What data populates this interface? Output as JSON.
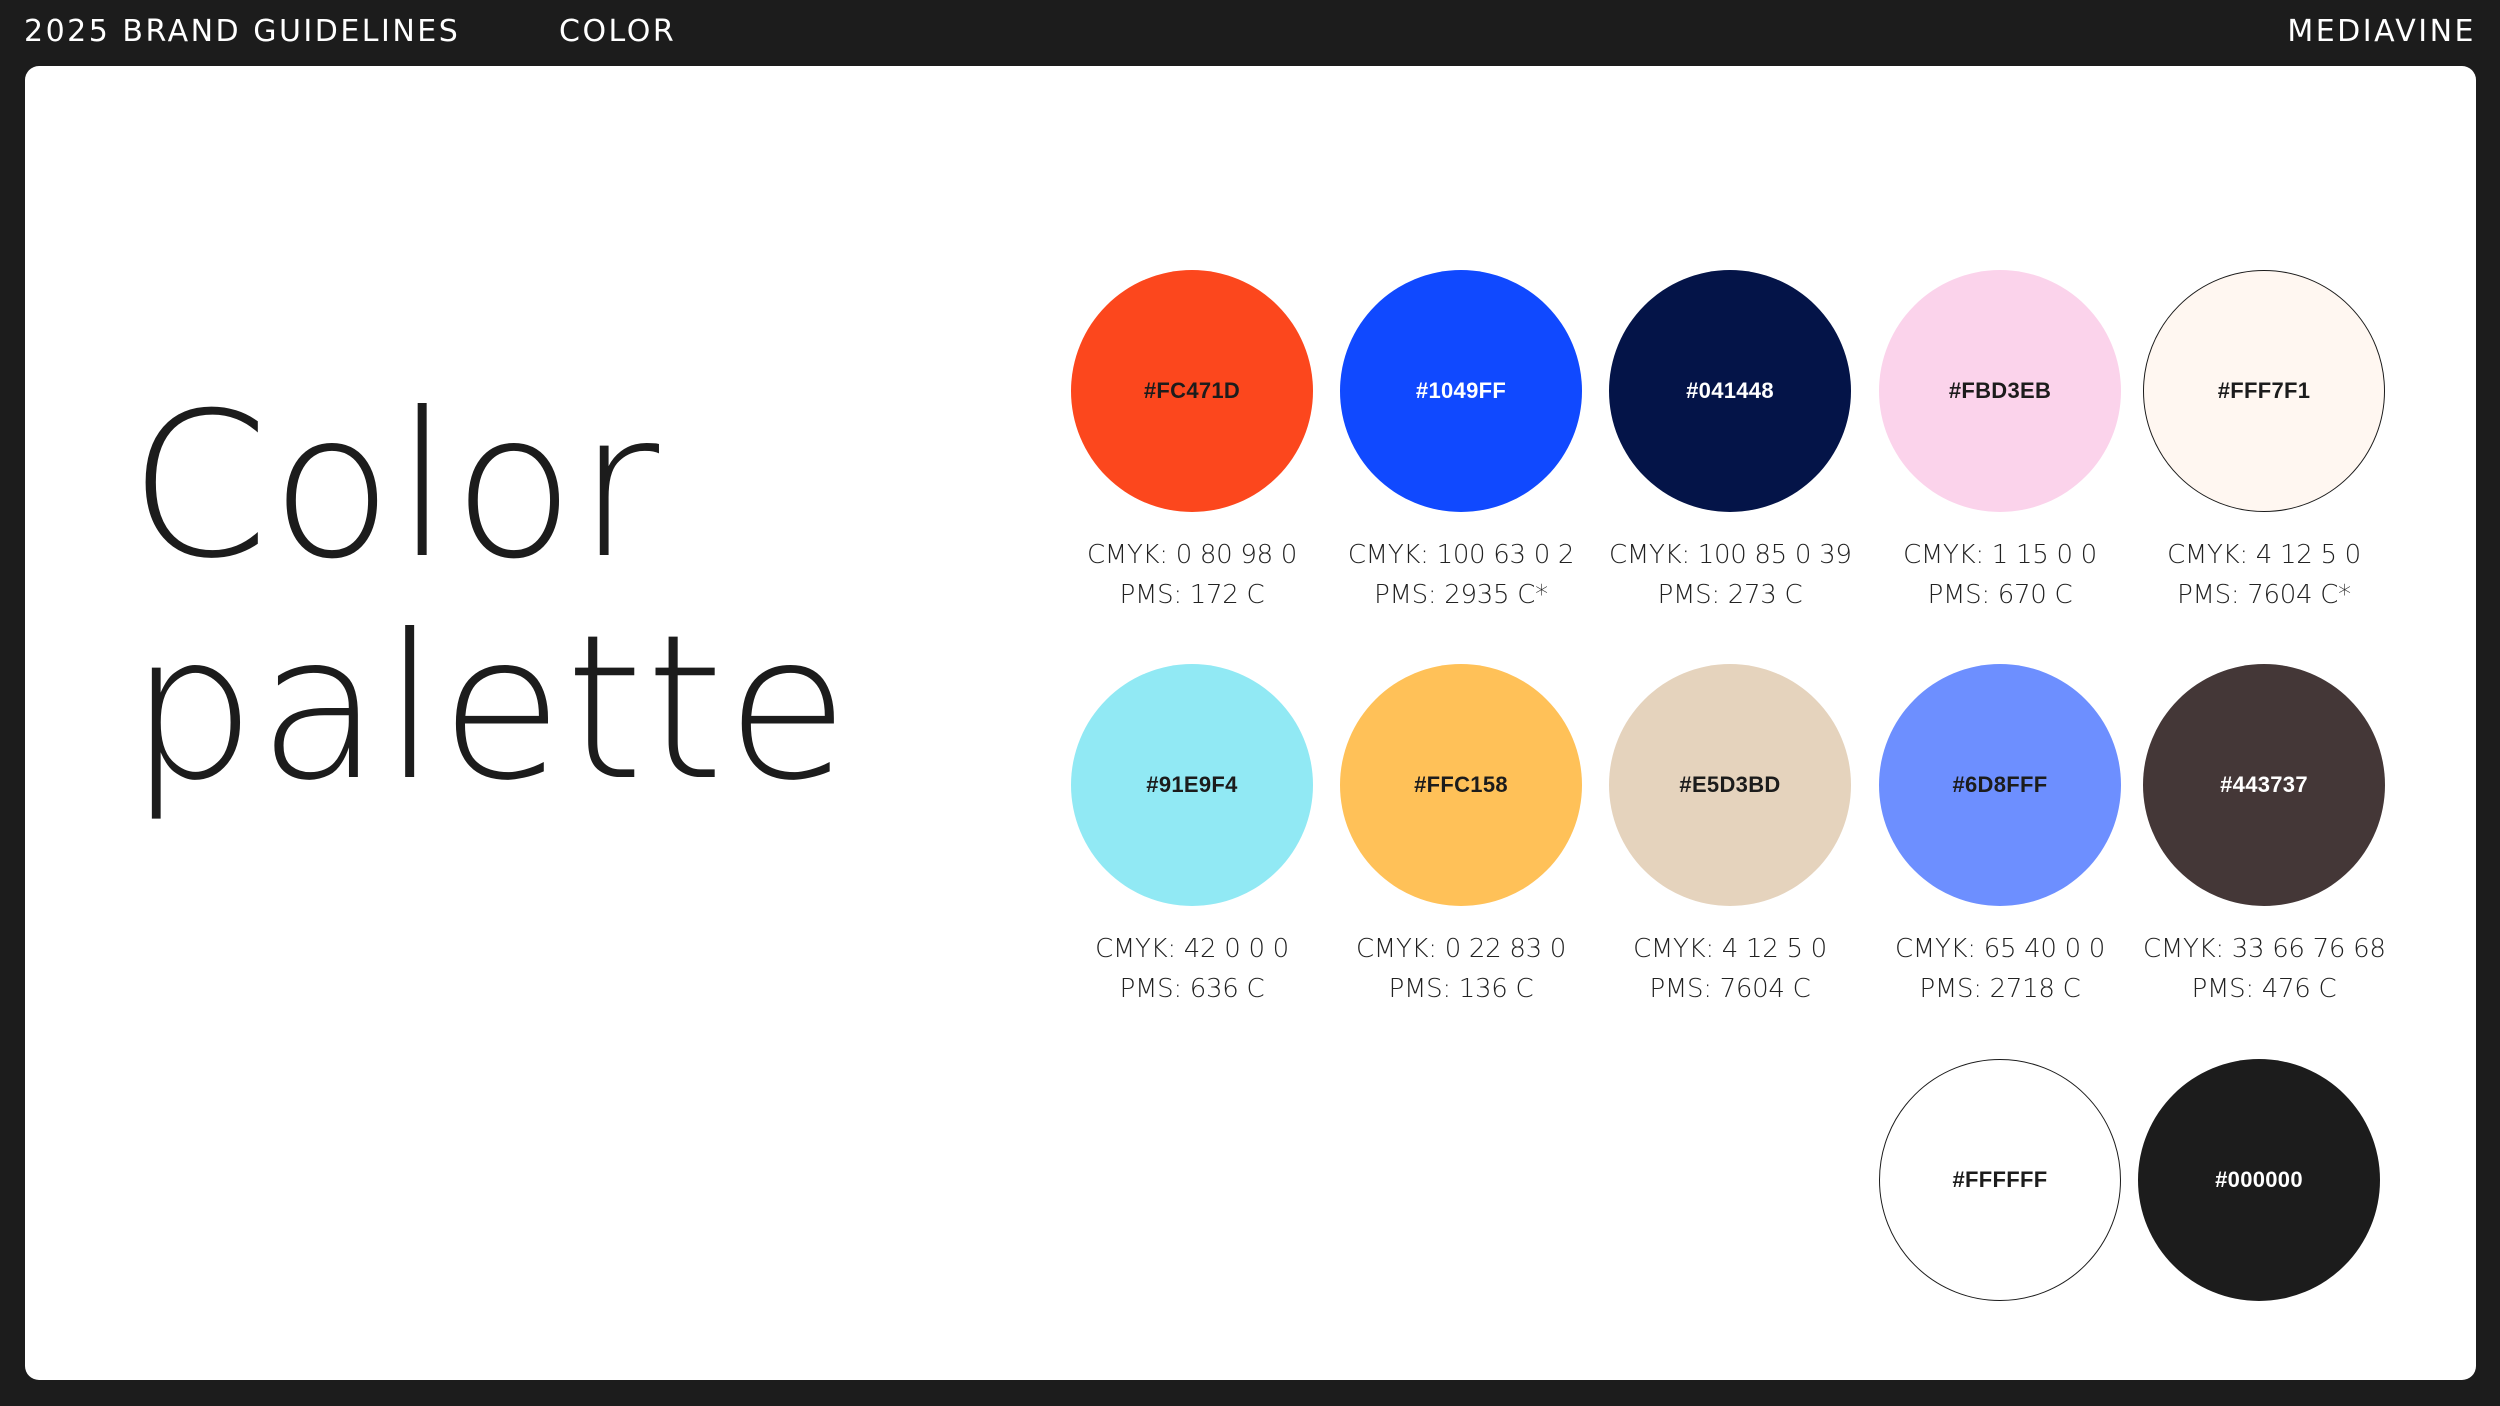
{
  "header": {
    "left": "2025 BRAND GUIDELINES",
    "center": "COLOR",
    "right": "MEDIAVINE"
  },
  "title": {
    "line1": "Color",
    "line2": "palette"
  },
  "swatches": [
    {
      "hex": "#FC471D",
      "fill": "#FC471D",
      "text_color": "#1c1c1c",
      "cmyk": "CMYK: 0 80 98 0",
      "pms": "PMS: 172 C"
    },
    {
      "hex": "#1049FF",
      "fill": "#1049FF",
      "text_color": "#ffffff",
      "cmyk": "CMYK: 100 63 0 2",
      "pms": "PMS: 2935 C*"
    },
    {
      "hex": "#041448",
      "fill": "#041448",
      "text_color": "#ffffff",
      "cmyk": "CMYK: 100 85 0 39",
      "pms": "PMS: 273 C"
    },
    {
      "hex": "#FBD3EB",
      "fill": "#FBD3EB",
      "text_color": "#1c1c1c",
      "cmyk": "CMYK: 1 15 0 0",
      "pms": "PMS: 670 C"
    },
    {
      "hex": "#FFF7F1",
      "fill": "#FFF7F1",
      "text_color": "#1c1c1c",
      "outlined": true,
      "cmyk": "CMYK: 4 12 5 0",
      "pms": "PMS: 7604 C*"
    },
    {
      "hex": "#91E9F4",
      "fill": "#91E9F4",
      "text_color": "#1c1c1c",
      "cmyk": "CMYK: 42 0 0 0",
      "pms": "PMS: 636 C"
    },
    {
      "hex": "#FFC158",
      "fill": "#FFC158",
      "text_color": "#1c1c1c",
      "cmyk": "CMYK: 0 22 83 0",
      "pms": "PMS: 136 C"
    },
    {
      "hex": "#E5D3BD",
      "fill": "#E5D3BD",
      "text_color": "#1c1c1c",
      "cmyk": "CMYK: 4 12 5 0",
      "pms": "PMS: 7604 C"
    },
    {
      "hex": "#6D8FFF",
      "fill": "#6D8FFF",
      "text_color": "#1c1c1c",
      "cmyk": "CMYK: 65 40 0 0",
      "pms": "PMS: 2718 C"
    },
    {
      "hex": "#443737",
      "fill": "#443737",
      "text_color": "#ffffff",
      "cmyk": "CMYK: 33 66 76 68",
      "pms": "PMS: 476 C"
    },
    {
      "hex": "#FFFFFF",
      "fill": "#FFFFFF",
      "text_color": "#1c1c1c",
      "outlined": true
    },
    {
      "hex": "#000000",
      "fill": "#1c1c1c",
      "text_color": "#ffffff"
    }
  ]
}
